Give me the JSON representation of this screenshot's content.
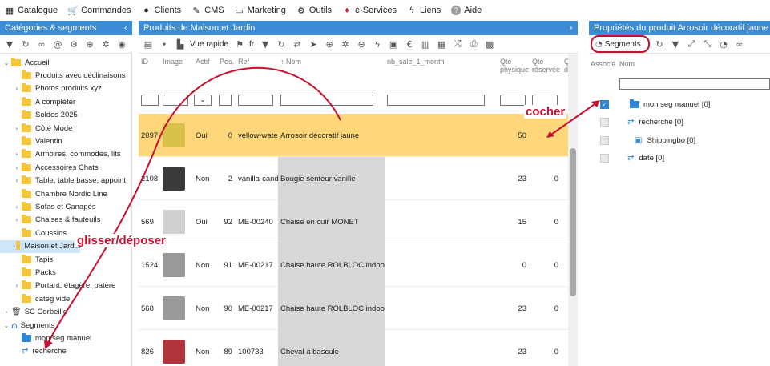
{
  "menu": [
    {
      "label": "Catalogue",
      "icon": "grid-icon"
    },
    {
      "label": "Commandes",
      "icon": "cart-icon"
    },
    {
      "label": "Clients",
      "icon": "user-icon"
    },
    {
      "label": "CMS",
      "icon": "edit-icon"
    },
    {
      "label": "Marketing",
      "icon": "megaphone-icon"
    },
    {
      "label": "Outils",
      "icon": "gear-icon"
    },
    {
      "label": "e-Services",
      "icon": "gem-icon"
    },
    {
      "label": "Liens",
      "icon": "bolt-icon"
    },
    {
      "label": "Aide",
      "icon": "help-icon"
    }
  ],
  "left_panel": {
    "title": "Catégories & segments"
  },
  "tree": [
    {
      "label": "Accueil",
      "level": 0,
      "caret": "open",
      "folder": "yellow"
    },
    {
      "label": "Produits avec déclinaisons",
      "level": 1,
      "caret": "",
      "folder": "yellow"
    },
    {
      "label": "Photos produits xyz",
      "level": 1,
      "caret": "closed",
      "folder": "yellow"
    },
    {
      "label": "A compléter",
      "level": 1,
      "caret": "",
      "folder": "yellow"
    },
    {
      "label": "Soldes 2025",
      "level": 1,
      "caret": "",
      "folder": "yellow"
    },
    {
      "label": "Côté Mode",
      "level": 1,
      "caret": "closed",
      "folder": "yellow"
    },
    {
      "label": "Valentin",
      "level": 1,
      "caret": "",
      "folder": "yellow"
    },
    {
      "label": "Armoires, commodes, lits",
      "level": 1,
      "caret": "closed",
      "folder": "yellow"
    },
    {
      "label": "Accessoires Chats",
      "level": 1,
      "caret": "closed",
      "folder": "yellow"
    },
    {
      "label": "Table, table basse, appoint",
      "level": 1,
      "caret": "closed",
      "folder": "yellow"
    },
    {
      "label": "Chambre Nordic Line",
      "level": 1,
      "caret": "",
      "folder": "yellow"
    },
    {
      "label": "Sofas et Canapés",
      "level": 1,
      "caret": "closed",
      "folder": "yellow"
    },
    {
      "label": "Chaises & fauteuils",
      "level": 1,
      "caret": "closed",
      "folder": "yellow"
    },
    {
      "label": "Coussins",
      "level": 1,
      "caret": "",
      "folder": "yellow"
    },
    {
      "label": "Maison et Jardin",
      "level": 1,
      "caret": "closed",
      "folder": "yellow",
      "selected": true
    },
    {
      "label": "Tapis",
      "level": 1,
      "caret": "",
      "folder": "yellow"
    },
    {
      "label": "Packs",
      "level": 1,
      "caret": "",
      "folder": "yellow"
    },
    {
      "label": "Portant, étagère, patère",
      "level": 1,
      "caret": "closed",
      "folder": "yellow"
    },
    {
      "label": "categ vide",
      "level": 1,
      "caret": "",
      "folder": "yellow"
    },
    {
      "label": "SC Corbeille",
      "level": 0,
      "caret": "closed",
      "folder": "trash"
    },
    {
      "label": "Segments",
      "level": 0,
      "caret": "open",
      "folder": "home"
    },
    {
      "label": "mon seg manuel",
      "level": 1,
      "caret": "",
      "folder": "blue"
    },
    {
      "label": "recherche",
      "level": 1,
      "caret": "",
      "folder": "sync"
    }
  ],
  "middle_panel": {
    "title": "Produits de Maison et Jardin",
    "view_label": "Vue rapide",
    "lang_label": "fr"
  },
  "columns": [
    {
      "label": "ID"
    },
    {
      "label": "Image"
    },
    {
      "label": "Actif"
    },
    {
      "label": "Pos."
    },
    {
      "label": "Ref"
    },
    {
      "label": "↑ Nom"
    },
    {
      "label": "nb_sale_1_month"
    },
    {
      "label": "Qté physique"
    },
    {
      "label": "Qté réservée"
    },
    {
      "label": "Qté dispo"
    }
  ],
  "rows": [
    {
      "id": "2097",
      "actif": "Oui",
      "pos": "0",
      "ref": "yellow-wate",
      "nom": "Arrosoir décoratif jaune",
      "qty": "50",
      "res": "",
      "highlight": true,
      "thumb": "#d9c04a"
    },
    {
      "id": "2108",
      "actif": "Non",
      "pos": "2",
      "ref": "vanilla-cand",
      "nom": "Bougie senteur vanille",
      "qty": "23",
      "res": "0",
      "highlight": false,
      "thumb": "#3a3a3a"
    },
    {
      "id": "569",
      "actif": "Oui",
      "pos": "92",
      "ref": "ME-00240",
      "nom": "Chaise en cuir MONET",
      "qty": "15",
      "res": "0",
      "highlight": false,
      "thumb": "#cfcfcf"
    },
    {
      "id": "1524",
      "actif": "Non",
      "pos": "91",
      "ref": "ME-00217",
      "nom": "Chaise haute ROLBLOC indoor",
      "qty": "0",
      "res": "0",
      "highlight": false,
      "thumb": "#9a9a9a"
    },
    {
      "id": "568",
      "actif": "Non",
      "pos": "90",
      "ref": "ME-00217",
      "nom": "Chaise haute ROLBLOC indoor",
      "qty": "23",
      "res": "0",
      "highlight": false,
      "thumb": "#9a9a9a"
    },
    {
      "id": "826",
      "actif": "Non",
      "pos": "89",
      "ref": "100733",
      "nom": "Cheval à bascule",
      "qty": "23",
      "res": "0",
      "highlight": false,
      "thumb": "#b0343a"
    }
  ],
  "right_panel": {
    "title": "Propriétés du produit Arrosoir décoratif jaune",
    "tab_label": "Segments",
    "col_assoc": "Associé",
    "col_nom": "Nom",
    "items": [
      {
        "label": "mon seg manuel [0]",
        "checked": true,
        "icon": "folder-icon"
      },
      {
        "label": "recherche [0]",
        "checked": false,
        "icon": "sync-icon"
      },
      {
        "label": "Shippingbo [0]",
        "checked": false,
        "icon": "folder-sync-icon"
      },
      {
        "label": "date [0]",
        "checked": false,
        "icon": "sync-icon"
      }
    ]
  },
  "annotations": {
    "drag": "glisser/déposer",
    "check": "cocher"
  },
  "colors": {
    "header_blue": "#3b8ed6",
    "highlight_row": "#fdd77a",
    "annotation_red": "#c8102e"
  }
}
